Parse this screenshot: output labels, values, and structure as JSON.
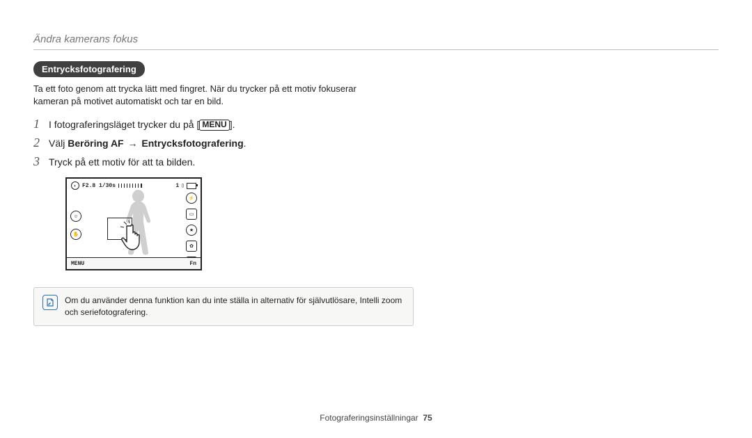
{
  "header": {
    "title": "Ändra kamerans fokus"
  },
  "section": {
    "pill": "Entrycksfotografering",
    "intro": "Ta ett foto genom att trycka lätt med fingret. När du trycker på ett motiv fokuserar kameran på motivet automatiskt och tar en bild."
  },
  "steps": {
    "s1_prefix": "I fotograferingsläget trycker du på [",
    "s1_menu": "MENU",
    "s1_suffix": "].",
    "s2_prefix": "Välj ",
    "s2_bold1": "Beröring AF",
    "s2_arrow": "→",
    "s2_bold2": "Entrycksfotografering",
    "s2_suffix": ".",
    "s3": "Tryck på ett motiv för att ta bilden.",
    "num1": "1",
    "num2": "2",
    "num3": "3"
  },
  "lcd": {
    "exposure_label": "F2.8 1/30s",
    "count": "1",
    "menu_btn": "MENU",
    "fn_btn": "Fn"
  },
  "note": {
    "text": "Om du använder denna funktion kan du inte ställa in alternativ för självutlösare, Intelli zoom och seriefotografering."
  },
  "footer": {
    "section": "Fotograferingsinställningar",
    "page": "75"
  }
}
